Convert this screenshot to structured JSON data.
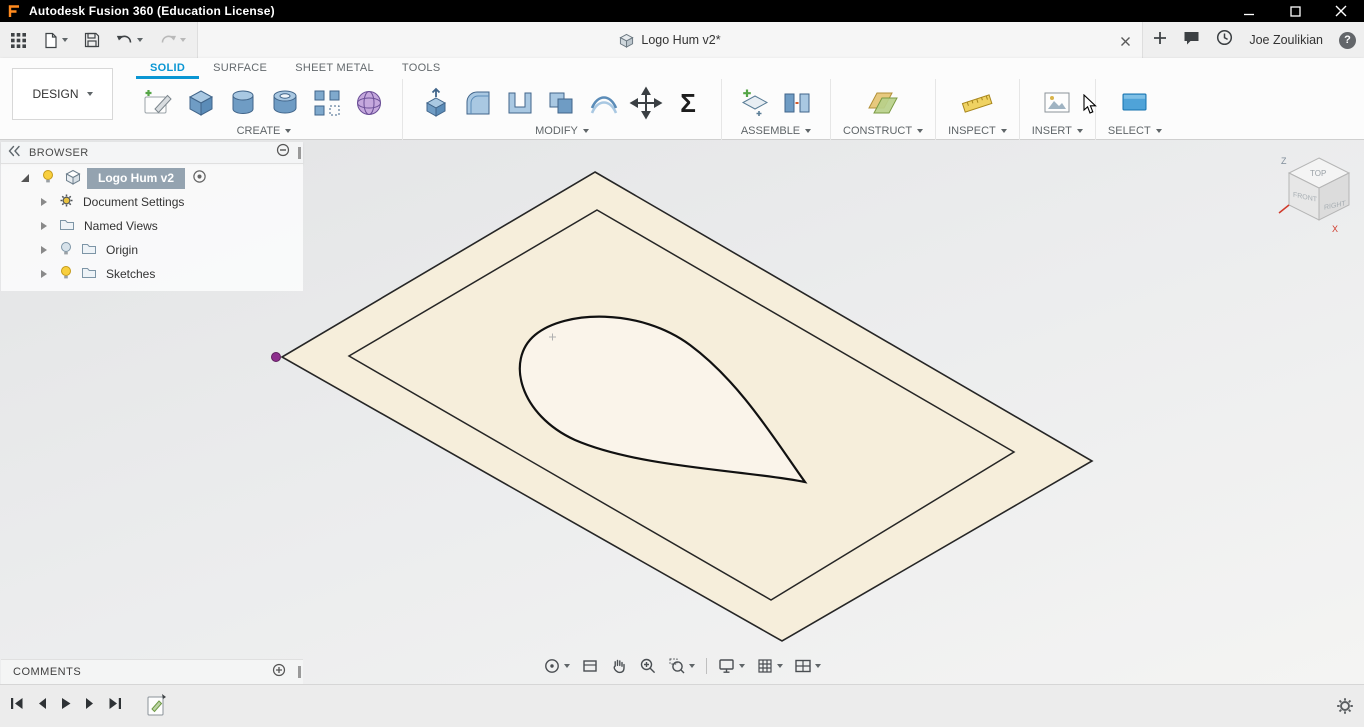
{
  "titlebar": {
    "app_title": "Autodesk Fusion 360 (Education License)"
  },
  "qat": {
    "document_tab": "Logo Hum v2*",
    "user_name": "Joe Zoulikian",
    "help_glyph": "?"
  },
  "ribbon": {
    "workspace_label": "DESIGN",
    "tabs": [
      {
        "label": "SOLID",
        "active": true
      },
      {
        "label": "SURFACE",
        "active": false
      },
      {
        "label": "SHEET METAL",
        "active": false
      },
      {
        "label": "TOOLS",
        "active": false
      }
    ],
    "groups": [
      {
        "label": "CREATE"
      },
      {
        "label": "MODIFY"
      },
      {
        "label": "ASSEMBLE"
      },
      {
        "label": "CONSTRUCT"
      },
      {
        "label": "INSPECT"
      },
      {
        "label": "INSERT"
      },
      {
        "label": "SELECT"
      }
    ],
    "sigma_glyph": "Σ"
  },
  "browser": {
    "header": "BROWSER",
    "root_label": "Logo Hum v2",
    "items": [
      {
        "label": "Document Settings"
      },
      {
        "label": "Named Views"
      },
      {
        "label": "Origin"
      },
      {
        "label": "Sketches"
      }
    ]
  },
  "viewcube": {
    "face_top": "TOP",
    "face_front": "FRONT",
    "face_right": "RIGHT",
    "axis_z": "Z",
    "axis_x": "X"
  },
  "comments": {
    "header": "COMMENTS"
  },
  "canvas": {
    "sketch": {
      "outer_fill": "#f6eedb",
      "teardrop_fill": "#faf4ea",
      "line_color": "#262626",
      "point_color": "#8d2f8d"
    }
  },
  "colors": {
    "accent_blue": "#0a96d3",
    "icon_steel": "#41658a",
    "icon_blue_fill": "#a9c8e2",
    "titlebar_bg": "#000000",
    "selected_row_bg": "#94a3b0"
  }
}
